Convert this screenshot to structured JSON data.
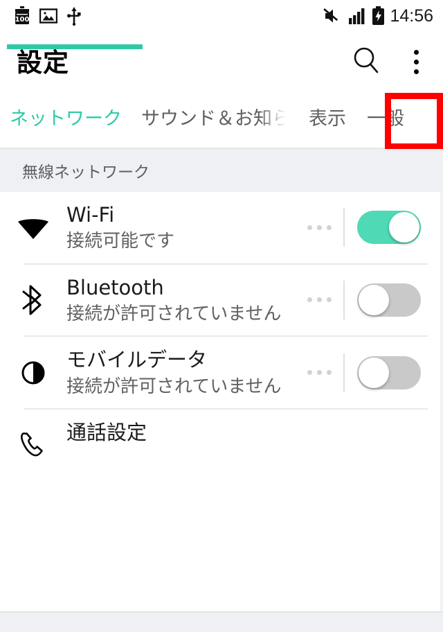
{
  "statusbar": {
    "time": "14:56",
    "left_icons": [
      {
        "name": "battery-100-icon",
        "label": "100"
      },
      {
        "name": "screenshot-image-icon",
        "label": "image"
      },
      {
        "name": "usb-icon",
        "label": "usb"
      }
    ],
    "right_icons": [
      {
        "name": "mute-icon",
        "label": "mute"
      },
      {
        "name": "signal-bars-icon",
        "label": "signal"
      },
      {
        "name": "battery-charging-icon",
        "label": "charging"
      }
    ]
  },
  "appbar": {
    "title": "設定",
    "search_label": "search-icon",
    "overflow_label": "more-options"
  },
  "tabs": {
    "items": [
      {
        "label": "ネットワーク",
        "active": true
      },
      {
        "label": "サウンド＆お知ら",
        "active": false
      },
      {
        "label": "表示",
        "active": false
      },
      {
        "label": "一般",
        "active": false
      }
    ],
    "active_index": 0,
    "highlight_index": 3,
    "highlight_color": "#fe0000",
    "accent_color": "#2ecaa6"
  },
  "section": {
    "header": "無線ネットワーク"
  },
  "rows": [
    {
      "icon": "wifi-icon",
      "title": "Wi-Fi",
      "subtitle": "接続可能です",
      "has_toggle": true,
      "toggle_state": "on",
      "toggle_color": "#4fd9b5",
      "has_dots": true
    },
    {
      "icon": "bluetooth-icon",
      "title": "Bluetooth",
      "subtitle": "接続が許可されていません",
      "has_toggle": true,
      "toggle_state": "off",
      "toggle_color": "#c9c9c9",
      "has_dots": true
    },
    {
      "icon": "mobile-data-icon",
      "title": "モバイルデータ",
      "subtitle": "接続が許可されていません",
      "has_toggle": true,
      "toggle_state": "off",
      "toggle_color": "#c9c9c9",
      "has_dots": true
    },
    {
      "icon": "phone-call-icon",
      "title": "通話設定",
      "subtitle": "",
      "has_toggle": false,
      "toggle_state": "",
      "toggle_color": "",
      "has_dots": false
    }
  ]
}
